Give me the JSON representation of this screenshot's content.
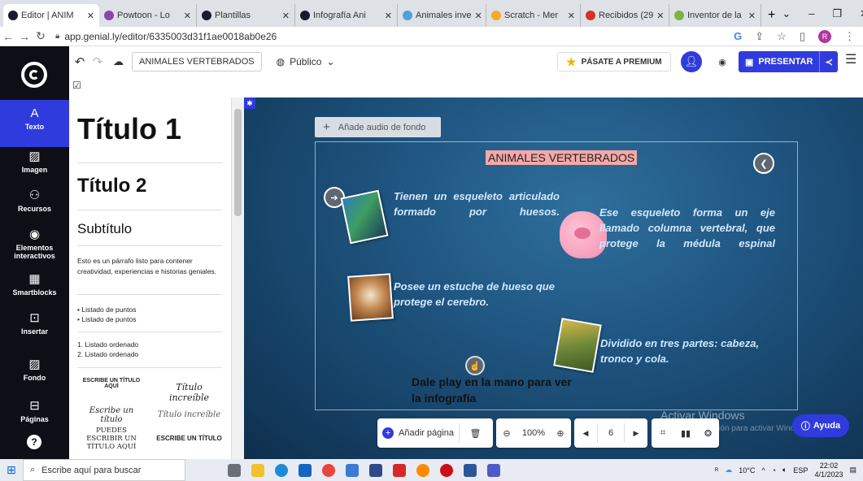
{
  "browser": {
    "tabs": [
      {
        "label": "Editor | ANIM",
        "color": "#1a1a2e",
        "active": true
      },
      {
        "label": "Powtoon - Lo",
        "color": "#8e44ad"
      },
      {
        "label": "Plantillas",
        "color": "#1a1a2e"
      },
      {
        "label": "Infografía Ani",
        "color": "#1a1a2e"
      },
      {
        "label": "Animales inve",
        "color": "#4aa3df"
      },
      {
        "label": "Scratch - Mer",
        "color": "#f9a825"
      },
      {
        "label": "Recibidos (29",
        "color": "#d93025"
      },
      {
        "label": "Inventor de la",
        "color": "#7cb342"
      }
    ],
    "url": "app.genial.ly/editor/6335003d31f1ae0018ab0e26",
    "profile_initial": "R"
  },
  "editor": {
    "title": "ANIMALES VERTEBRADOS",
    "visibility": "Público",
    "premium_label": "PÁSATE A PREMIUM",
    "present_label": "PRESENTAR"
  },
  "sidebar": {
    "items": [
      {
        "label": "Texto",
        "icon": "A"
      },
      {
        "label": "Imagen",
        "icon": "▨"
      },
      {
        "label": "Recursos",
        "icon": "⚇"
      },
      {
        "label": "Elementos interactivos",
        "icon": "◉"
      },
      {
        "label": "Smartblocks",
        "icon": "▦"
      },
      {
        "label": "Insertar",
        "icon": "⊡"
      },
      {
        "label": "Fondo",
        "icon": "▨"
      },
      {
        "label": "Páginas",
        "icon": "⊟"
      }
    ],
    "help_icon": "?"
  },
  "text_panel": {
    "h1": "Título 1",
    "h2": "Título 2",
    "subtitle": "Subtítulo",
    "paragraph": "Esto es un párrafo listo para contener creatividad, experiencias e historias geniales.",
    "bullets": [
      "Listado de puntos",
      "Listado de puntos"
    ],
    "ordered": [
      "1. Listado ordenado",
      "2. Listado ordenado"
    ],
    "samples": [
      "ESCRIBE UN TÍTULO AQUÍ",
      "Título increíble",
      "Escribe un título",
      "Título increíble",
      "PUEDES ESCRIBIR UN TÍTULO AQUÍ",
      "ESCRIBE UN TÍTULO"
    ]
  },
  "slide": {
    "audio_label": "Añade audio de fondo",
    "title": "ANIMALES VERTEBRADOS",
    "text_skeleton": "Tienen un esqueleto articulado formado por huesos.",
    "text_column": "Ese esqueleto forma un eje llamado columna vertebral, que protege la médula espinal",
    "text_skull": "Posee un estuche de hueso que protege el cerebro.",
    "text_parts": "Dividido en tres partes: cabeza, tronco y cola.",
    "play_hint": "Dale play en la mano para ver la infografía"
  },
  "bottom_toolbar": {
    "add_page": "Añadir página",
    "zoom": "100%",
    "page": "6"
  },
  "windows": {
    "watermark_title": "Activar Windows",
    "watermark_sub": "Ve a Configuración para activar Windows.",
    "help_label": "Ayuda",
    "search_placeholder": "Escribe aquí para buscar",
    "temperature": "10°C",
    "language": "ESP",
    "time": "22:02",
    "date": "4/1/2023"
  }
}
